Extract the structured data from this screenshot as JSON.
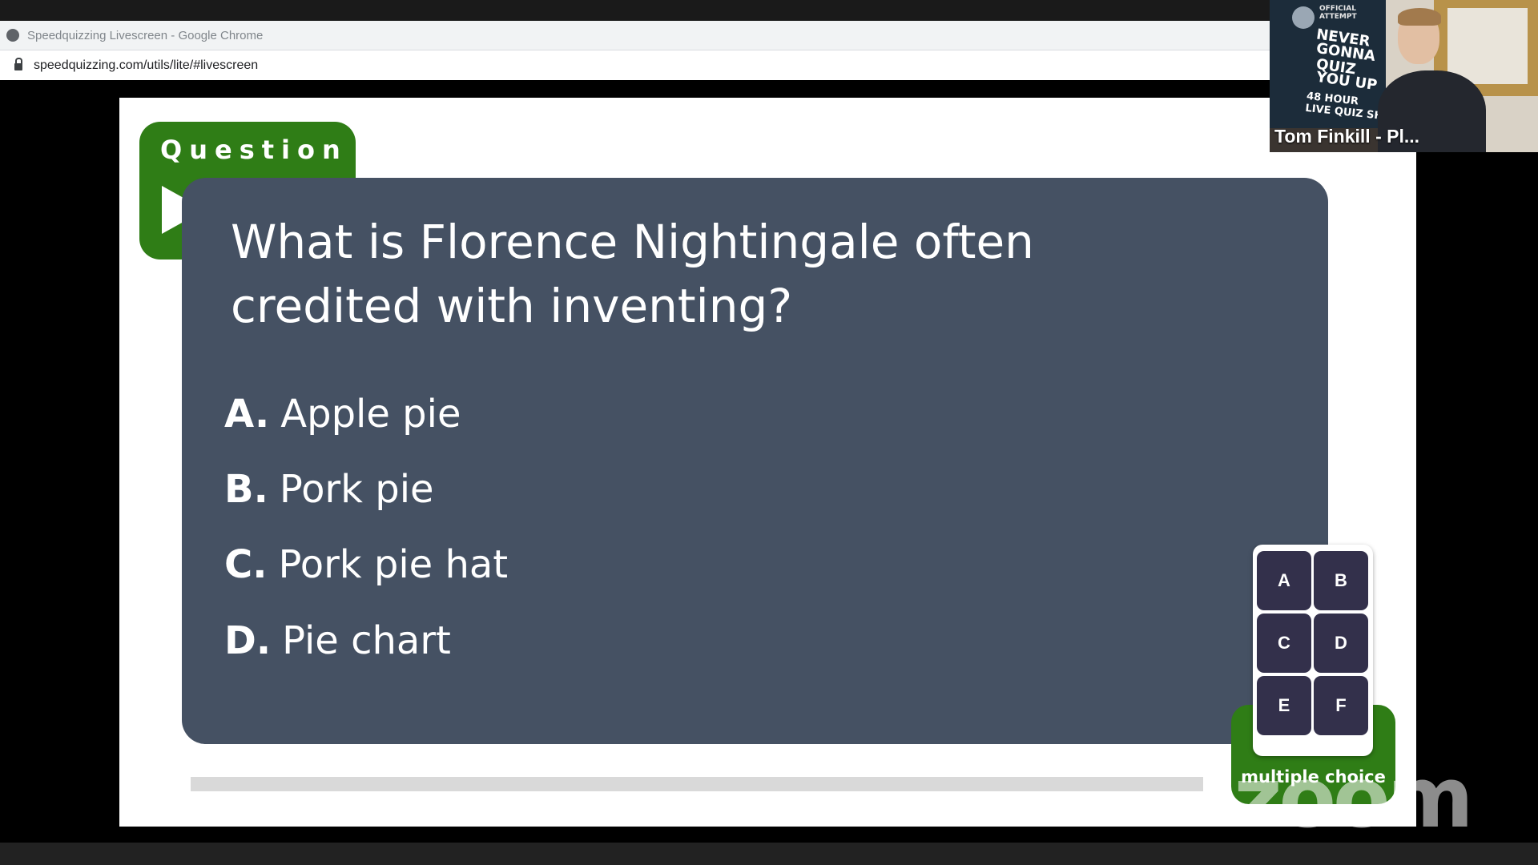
{
  "browser": {
    "window_title": "Speedquizzing Livescreen - Google Chrome",
    "url": "speedquizzing.com/utils/lite/#livescreen"
  },
  "slide": {
    "tab_label": "Question",
    "question": "What is Florence Nightingale often credited with inventing?",
    "options": [
      {
        "letter": "A.",
        "text": "Apple pie"
      },
      {
        "letter": "B.",
        "text": "Pork pie"
      },
      {
        "letter": "C.",
        "text": "Pork pie hat"
      },
      {
        "letter": "D.",
        "text": "Pie chart"
      }
    ],
    "keypad_keys": [
      "A",
      "B",
      "C",
      "D",
      "E",
      "F"
    ],
    "mode_label": "multiple choice"
  },
  "video": {
    "participant_name": "Tom Finkill - Pl...",
    "poster_lines": [
      "NEVER",
      "GONNA",
      "QUIZ",
      "YOU UP"
    ],
    "poster_badge": "OFFICIAL ATTEMPT",
    "poster_bottom": "48 HOUR LIVE QUIZ SH"
  },
  "watermark": "zoom",
  "colors": {
    "accent_green": "#2f7d16",
    "card_slate": "#455163",
    "keypad_key": "#33304b"
  }
}
